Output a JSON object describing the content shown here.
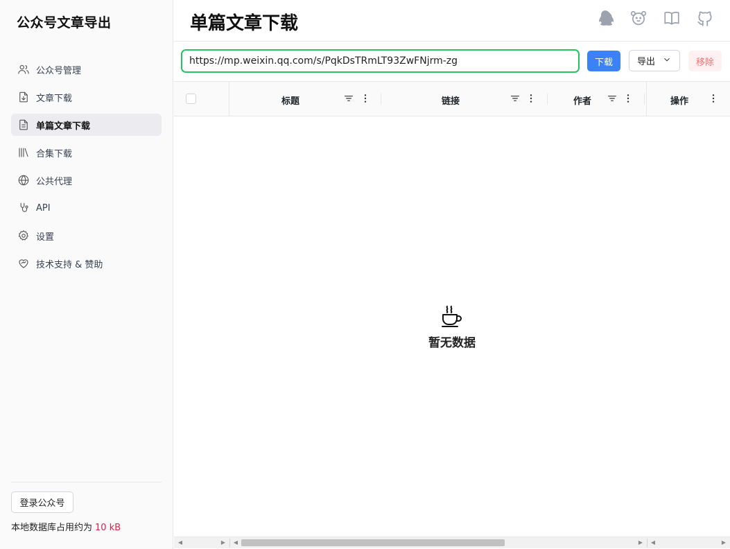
{
  "app": {
    "brand": "公众号文章导出"
  },
  "sidebar": {
    "items": [
      {
        "label": "公众号管理",
        "icon": "users-icon",
        "active": false
      },
      {
        "label": "文章下载",
        "icon": "file-download-icon",
        "active": false
      },
      {
        "label": "单篇文章下载",
        "icon": "document-icon",
        "active": true
      },
      {
        "label": "合集下载",
        "icon": "library-icon",
        "active": false
      },
      {
        "label": "公共代理",
        "icon": "globe-icon",
        "active": false
      },
      {
        "label": "API",
        "icon": "api-icon",
        "active": false
      },
      {
        "label": "设置",
        "icon": "gear-icon",
        "active": false
      },
      {
        "label": "技术支持 & 赞助",
        "icon": "heart-handshake-icon",
        "active": false
      }
    ],
    "login_label": "登录公众号",
    "db_usage_label": "本地数据库占用约为",
    "db_usage_value": "10 kB"
  },
  "header": {
    "title": "单篇文章下载",
    "icons": [
      "penguin-icon",
      "dog-icon",
      "book-icon",
      "github-icon"
    ]
  },
  "toolbar": {
    "url_value": "https://mp.weixin.qq.com/s/PqkDsTRmLT93ZwFNjrm-zg",
    "download_label": "下载",
    "export_label": "导出",
    "remove_label": "移除"
  },
  "table": {
    "columns": [
      "标题",
      "链接",
      "作者",
      "操作"
    ],
    "empty_text": "暂无数据"
  },
  "colors": {
    "accent": "#3b82f6",
    "input_border": "#22c55e",
    "danger": "#e11d48"
  }
}
